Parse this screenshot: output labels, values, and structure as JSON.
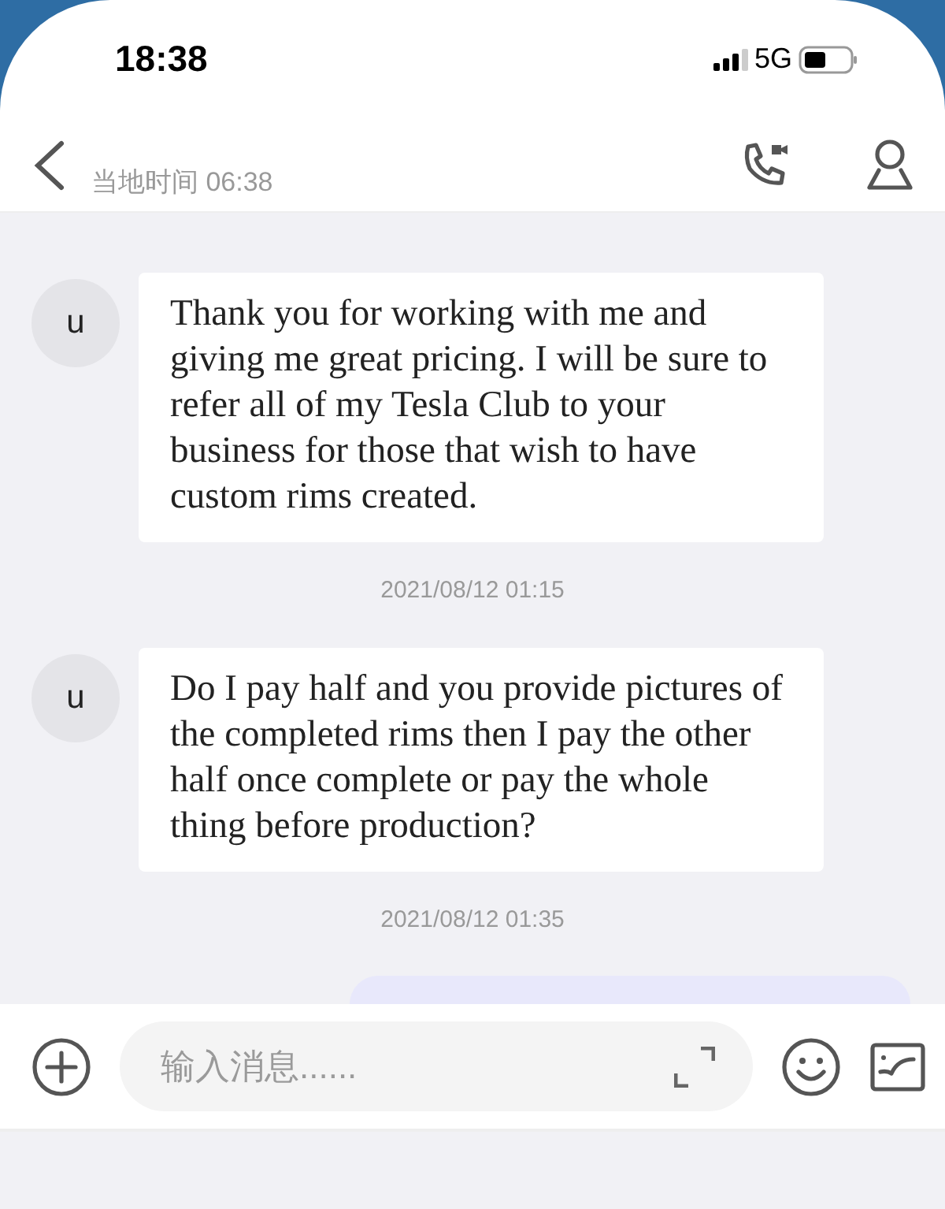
{
  "status_bar": {
    "time": "18:38",
    "network": "5G"
  },
  "header": {
    "local_time": "当地时间 06:38"
  },
  "messages": [
    {
      "kind": "incoming",
      "avatar": "u",
      "text": "Thank you for working with me and giving me great pricing.  I will be sure to refer all of my Tesla Club to your business for those that wish to have custom rims created."
    },
    {
      "kind": "timestamp",
      "text": "2021/08/12 01:15"
    },
    {
      "kind": "incoming",
      "avatar": "u",
      "text": "Do I pay half and you provide pictures of the completed rims then I pay the other half once complete or pay the whole thing before production?"
    },
    {
      "kind": "timestamp",
      "text": "2021/08/12 01:35"
    },
    {
      "kind": "outgoing"
    }
  ],
  "composer": {
    "placeholder": "输入消息......"
  }
}
